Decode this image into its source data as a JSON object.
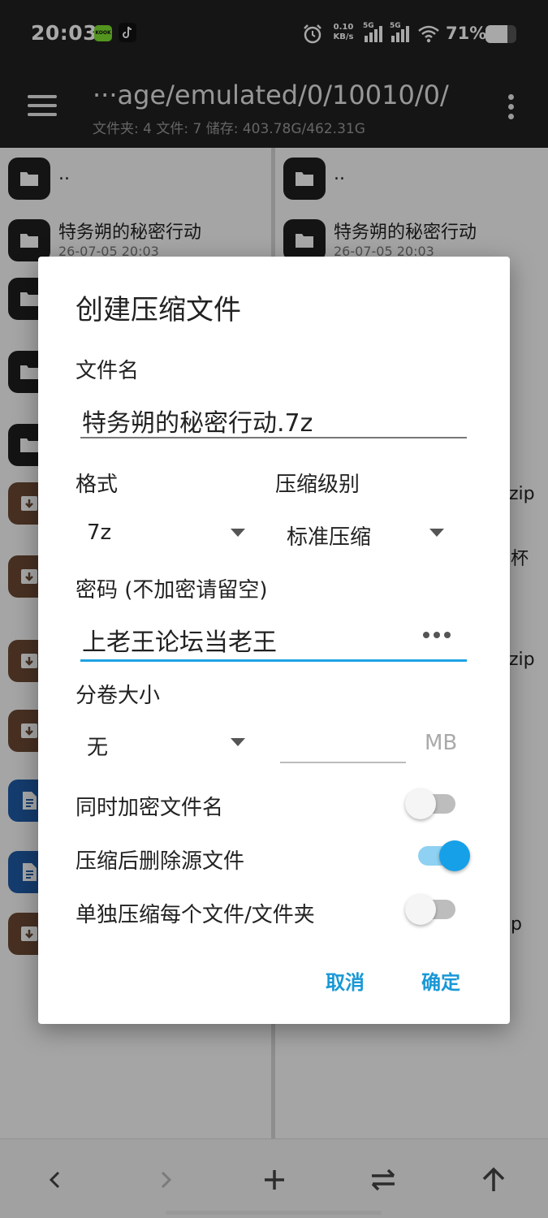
{
  "status_bar": {
    "time": "20:03",
    "app_badge": "KOOK",
    "net_speed_value": "0.10",
    "net_speed_unit": "KB/s",
    "sim1_label": "5G",
    "sim2_label": "5G",
    "battery_text": "71%",
    "battery_level": 0.71
  },
  "app_bar": {
    "path": "···age/emulated/0/10010/0/",
    "summary": "文件夹: 4  文件: 7  储存: 403.78G/462.31G"
  },
  "left_pane": {
    "parent": "..",
    "rows": [
      {
        "name": "特务朔的秘密行动",
        "meta": "26-07-05 20:03",
        "type": "folder"
      }
    ]
  },
  "right_pane": {
    "parent": "..",
    "rows": [
      {
        "name": "特务朔的秘密行动",
        "meta": "26-07-05 20:03",
        "type": "folder"
      }
    ],
    "partial_texts": [
      "zip",
      "杯",
      "zip",
      "p"
    ]
  },
  "dialog": {
    "title": "创建压缩文件",
    "filename_label": "文件名",
    "filename_value": "特务朔的秘密行动.7z",
    "format_label": "格式",
    "format_value": "7z",
    "level_label": "压缩级别",
    "level_value": "标准压缩",
    "password_label": "密码 (不加密请留空)",
    "password_value": "上老王论坛当老王",
    "volume_label": "分卷大小",
    "volume_value": "无",
    "volume_unit": "MB",
    "toggles": [
      {
        "label": "同时加密文件名",
        "on": false
      },
      {
        "label": "压缩后删除源文件",
        "on": true
      },
      {
        "label": "单独压缩每个文件/文件夹",
        "on": false
      }
    ],
    "cancel": "取消",
    "confirm": "确定"
  },
  "colors": {
    "accent": "#1ea3e3",
    "toolbar": "#212121",
    "folder_icon": "#1f1f1f",
    "archive_icon": "#6d4a34",
    "doc_icon": "#1f5ba8"
  },
  "icons": {
    "bottom_bar": [
      "back-icon",
      "forward-icon",
      "add-icon",
      "swap-icon",
      "up-icon"
    ]
  }
}
